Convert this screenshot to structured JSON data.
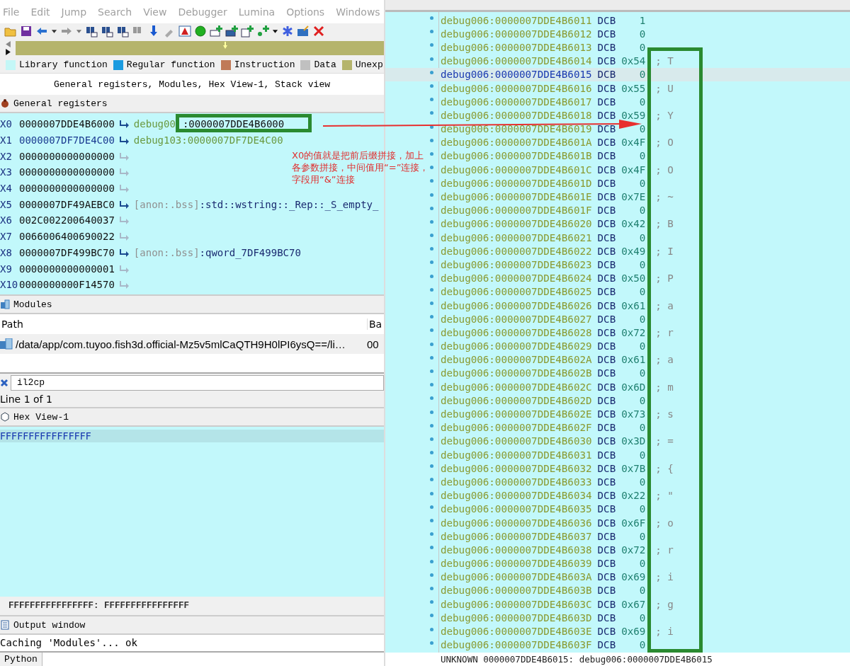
{
  "menu": [
    "File",
    "Edit",
    "Jump",
    "Search",
    "View",
    "Debugger",
    "Lumina",
    "Options",
    "Windows"
  ],
  "legend": [
    {
      "label": "Library function",
      "color": "#c4f7f7"
    },
    {
      "label": "Regular function",
      "color": "#1b9be0"
    },
    {
      "label": "Instruction",
      "color": "#c07a58"
    },
    {
      "label": "Data",
      "color": "#c0c0c0"
    },
    {
      "label": "Unexp",
      "color": "#b5b46c"
    }
  ],
  "tab_line": "General registers, Modules, Hex View-1, Stack view",
  "registers_panel": {
    "title": "General registers",
    "rows": [
      {
        "name": "X0",
        "value": "0000007DDE4B6000",
        "changed": false,
        "target": [
          {
            "text": "debug00",
            "kind": "segment"
          },
          {
            "text": ":0000007DDE4B6000",
            "kind": "plain"
          }
        ]
      },
      {
        "name": "X1",
        "value": "0000007DF7DE4C00",
        "changed": true,
        "target": [
          {
            "text": "debug103:0000007DF7DE4C00",
            "kind": "segment"
          }
        ]
      },
      {
        "name": "X2",
        "value": "0000000000000000",
        "changed": false
      },
      {
        "name": "X3",
        "value": "0000000000000000",
        "changed": false
      },
      {
        "name": "X4",
        "value": "0000000000000000",
        "changed": false
      },
      {
        "name": "X5",
        "value": "0000007DF49AEBC0",
        "changed": false,
        "target": [
          {
            "text": "[anon:.bss]",
            "kind": "section"
          },
          {
            "text": ":std::wstring::_Rep::_S_empty_",
            "kind": "symbol"
          }
        ]
      },
      {
        "name": "X6",
        "value": "002C002200640037",
        "changed": false
      },
      {
        "name": "X7",
        "value": "0066006400690022",
        "changed": false
      },
      {
        "name": "X8",
        "value": "0000007DF499BC70",
        "changed": false,
        "target": [
          {
            "text": "[anon:.bss]",
            "kind": "section"
          },
          {
            "text": ":qword_7DF499BC70",
            "kind": "symbol"
          }
        ]
      },
      {
        "name": "X9",
        "value": "0000000000000001",
        "changed": false
      },
      {
        "name": "X10",
        "value": "0000000000F14570",
        "changed": false
      }
    ]
  },
  "modules_panel": {
    "title": "Modules",
    "columns": [
      "Path",
      "Ba"
    ],
    "rows": [
      [
        "/data/app/com.tuyoo.fish3d.official-Mz5v5mlCaQTH9H0lPI6ysQ==/li…",
        "00"
      ]
    ],
    "filter": {
      "value": "il2cp"
    },
    "line_info": "Line 1 of 1"
  },
  "hex_panel": {
    "title": "Hex View-1",
    "row": "FFFFFFFFFFFFFFFF",
    "status": "FFFFFFFFFFFFFFFF: FFFFFFFFFFFFFFFF"
  },
  "output_panel": {
    "title": "Output window",
    "lines": [
      "Caching 'Modules'... ok"
    ],
    "language": "Python"
  },
  "listing": {
    "rows": [
      {
        "address": "debug006:0000007DDE4B6011",
        "op": "DCB",
        "value": "1",
        "selected": false
      },
      {
        "address": "debug006:0000007DDE4B6012",
        "op": "DCB",
        "value": "0",
        "selected": false
      },
      {
        "address": "debug006:0000007DDE4B6013",
        "op": "DCB",
        "value": "0",
        "selected": false
      },
      {
        "address": "debug006:0000007DDE4B6014",
        "op": "DCB",
        "value": "0x54",
        "comment": "; T",
        "selected": false
      },
      {
        "address": "debug006:0000007DDE4B6015",
        "op": "DCB",
        "value": "0",
        "selected": true
      },
      {
        "address": "debug006:0000007DDE4B6016",
        "op": "DCB",
        "value": "0x55",
        "comment": "; U",
        "selected": false
      },
      {
        "address": "debug006:0000007DDE4B6017",
        "op": "DCB",
        "value": "0",
        "selected": false
      },
      {
        "address": "debug006:0000007DDE4B6018",
        "op": "DCB",
        "value": "0x59",
        "comment": "; Y",
        "selected": false
      },
      {
        "address": "debug006:0000007DDE4B6019",
        "op": "DCB",
        "value": "0",
        "selected": false
      },
      {
        "address": "debug006:0000007DDE4B601A",
        "op": "DCB",
        "value": "0x4F",
        "comment": "; O",
        "selected": false
      },
      {
        "address": "debug006:0000007DDE4B601B",
        "op": "DCB",
        "value": "0",
        "selected": false
      },
      {
        "address": "debug006:0000007DDE4B601C",
        "op": "DCB",
        "value": "0x4F",
        "comment": "; O",
        "selected": false
      },
      {
        "address": "debug006:0000007DDE4B601D",
        "op": "DCB",
        "value": "0",
        "selected": false
      },
      {
        "address": "debug006:0000007DDE4B601E",
        "op": "DCB",
        "value": "0x7E",
        "comment": "; ~",
        "selected": false
      },
      {
        "address": "debug006:0000007DDE4B601F",
        "op": "DCB",
        "value": "0",
        "selected": false
      },
      {
        "address": "debug006:0000007DDE4B6020",
        "op": "DCB",
        "value": "0x42",
        "comment": "; B",
        "selected": false
      },
      {
        "address": "debug006:0000007DDE4B6021",
        "op": "DCB",
        "value": "0",
        "selected": false
      },
      {
        "address": "debug006:0000007DDE4B6022",
        "op": "DCB",
        "value": "0x49",
        "comment": "; I",
        "selected": false
      },
      {
        "address": "debug006:0000007DDE4B6023",
        "op": "DCB",
        "value": "0",
        "selected": false
      },
      {
        "address": "debug006:0000007DDE4B6024",
        "op": "DCB",
        "value": "0x50",
        "comment": "; P",
        "selected": false
      },
      {
        "address": "debug006:0000007DDE4B6025",
        "op": "DCB",
        "value": "0",
        "selected": false
      },
      {
        "address": "debug006:0000007DDE4B6026",
        "op": "DCB",
        "value": "0x61",
        "comment": "; a",
        "selected": false
      },
      {
        "address": "debug006:0000007DDE4B6027",
        "op": "DCB",
        "value": "0",
        "selected": false
      },
      {
        "address": "debug006:0000007DDE4B6028",
        "op": "DCB",
        "value": "0x72",
        "comment": "; r",
        "selected": false
      },
      {
        "address": "debug006:0000007DDE4B6029",
        "op": "DCB",
        "value": "0",
        "selected": false
      },
      {
        "address": "debug006:0000007DDE4B602A",
        "op": "DCB",
        "value": "0x61",
        "comment": "; a",
        "selected": false
      },
      {
        "address": "debug006:0000007DDE4B602B",
        "op": "DCB",
        "value": "0",
        "selected": false
      },
      {
        "address": "debug006:0000007DDE4B602C",
        "op": "DCB",
        "value": "0x6D",
        "comment": "; m",
        "selected": false
      },
      {
        "address": "debug006:0000007DDE4B602D",
        "op": "DCB",
        "value": "0",
        "selected": false
      },
      {
        "address": "debug006:0000007DDE4B602E",
        "op": "DCB",
        "value": "0x73",
        "comment": "; s",
        "selected": false
      },
      {
        "address": "debug006:0000007DDE4B602F",
        "op": "DCB",
        "value": "0",
        "selected": false
      },
      {
        "address": "debug006:0000007DDE4B6030",
        "op": "DCB",
        "value": "0x3D",
        "comment": "; =",
        "selected": false
      },
      {
        "address": "debug006:0000007DDE4B6031",
        "op": "DCB",
        "value": "0",
        "selected": false
      },
      {
        "address": "debug006:0000007DDE4B6032",
        "op": "DCB",
        "value": "0x7B",
        "comment": "; {",
        "selected": false
      },
      {
        "address": "debug006:0000007DDE4B6033",
        "op": "DCB",
        "value": "0",
        "selected": false
      },
      {
        "address": "debug006:0000007DDE4B6034",
        "op": "DCB",
        "value": "0x22",
        "comment": "; \"",
        "selected": false
      },
      {
        "address": "debug006:0000007DDE4B6035",
        "op": "DCB",
        "value": "0",
        "selected": false
      },
      {
        "address": "debug006:0000007DDE4B6036",
        "op": "DCB",
        "value": "0x6F",
        "comment": "; o",
        "selected": false
      },
      {
        "address": "debug006:0000007DDE4B6037",
        "op": "DCB",
        "value": "0",
        "selected": false
      },
      {
        "address": "debug006:0000007DDE4B6038",
        "op": "DCB",
        "value": "0x72",
        "comment": "; r",
        "selected": false
      },
      {
        "address": "debug006:0000007DDE4B6039",
        "op": "DCB",
        "value": "0",
        "selected": false
      },
      {
        "address": "debug006:0000007DDE4B603A",
        "op": "DCB",
        "value": "0x69",
        "comment": "; i",
        "selected": false
      },
      {
        "address": "debug006:0000007DDE4B603B",
        "op": "DCB",
        "value": "0",
        "selected": false
      },
      {
        "address": "debug006:0000007DDE4B603C",
        "op": "DCB",
        "value": "0x67",
        "comment": "; g",
        "selected": false
      },
      {
        "address": "debug006:0000007DDE4B603D",
        "op": "DCB",
        "value": "0",
        "selected": false
      },
      {
        "address": "debug006:0000007DDE4B603E",
        "op": "DCB",
        "value": "0x69",
        "comment": "; i",
        "selected": false
      },
      {
        "address": "debug006:0000007DDE4B603F",
        "op": "DCB",
        "value": "0",
        "selected": false
      }
    ],
    "status": "UNKNOWN 0000007DDE4B6015: debug006:0000007DDE4B6015"
  },
  "annotation": {
    "note": "X0的值就是把前后缀拼接，加上各参数拼接，中间值用“=”连接，字段用“&”连接"
  }
}
